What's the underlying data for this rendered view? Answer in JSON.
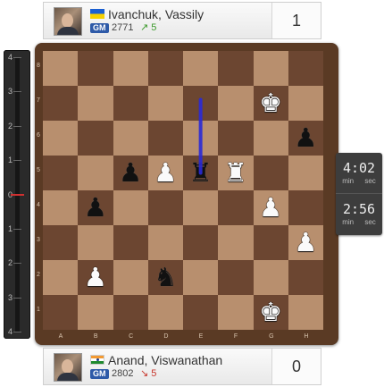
{
  "top_player": {
    "name": "Ivanchuk, Vassily",
    "flag": "ukraine-flag",
    "title": "GM",
    "rating": "2771",
    "trend": "↗ 5",
    "trend_direction": "up",
    "score": "1"
  },
  "bottom_player": {
    "name": "Anand, Viswanathan",
    "flag": "india-flag",
    "title": "GM",
    "rating": "2802",
    "trend": "↘ 5",
    "trend_direction": "down",
    "score": "0"
  },
  "eval_bar": {
    "labels": [
      "4",
      "3",
      "2",
      "1",
      "0",
      "1",
      "2",
      "3",
      "4"
    ],
    "value": 0
  },
  "clocks": {
    "top": {
      "time": "4:02",
      "min": "min",
      "sec": "sec"
    },
    "bottom": {
      "time": "2:56",
      "min": "min",
      "sec": "sec"
    }
  },
  "board": {
    "files": [
      "A",
      "B",
      "C",
      "D",
      "E",
      "F",
      "G",
      "H"
    ],
    "ranks": [
      "8",
      "7",
      "6",
      "5",
      "4",
      "3",
      "2",
      "1"
    ],
    "pieces": [
      {
        "square": "g7",
        "piece": "king",
        "color": "white"
      },
      {
        "square": "h6",
        "piece": "pawn",
        "color": "black"
      },
      {
        "square": "c5",
        "piece": "pawn",
        "color": "black"
      },
      {
        "square": "d5",
        "piece": "pawn",
        "color": "white"
      },
      {
        "square": "e5",
        "piece": "rook",
        "color": "black"
      },
      {
        "square": "f5",
        "piece": "rook",
        "color": "white"
      },
      {
        "square": "b4",
        "piece": "pawn",
        "color": "black"
      },
      {
        "square": "g4",
        "piece": "pawn",
        "color": "white"
      },
      {
        "square": "h3",
        "piece": "pawn",
        "color": "white"
      },
      {
        "square": "b2",
        "piece": "pawn",
        "color": "white"
      },
      {
        "square": "d2",
        "piece": "knight",
        "color": "black"
      },
      {
        "square": "g1",
        "piece": "king",
        "color": "white"
      }
    ],
    "arrow": {
      "from": "e7",
      "to": "e5",
      "color": "#2a2ad8"
    },
    "colors": {
      "light": "#b88f6e",
      "dark": "#6c4631",
      "frame": "#5a3a24"
    }
  }
}
